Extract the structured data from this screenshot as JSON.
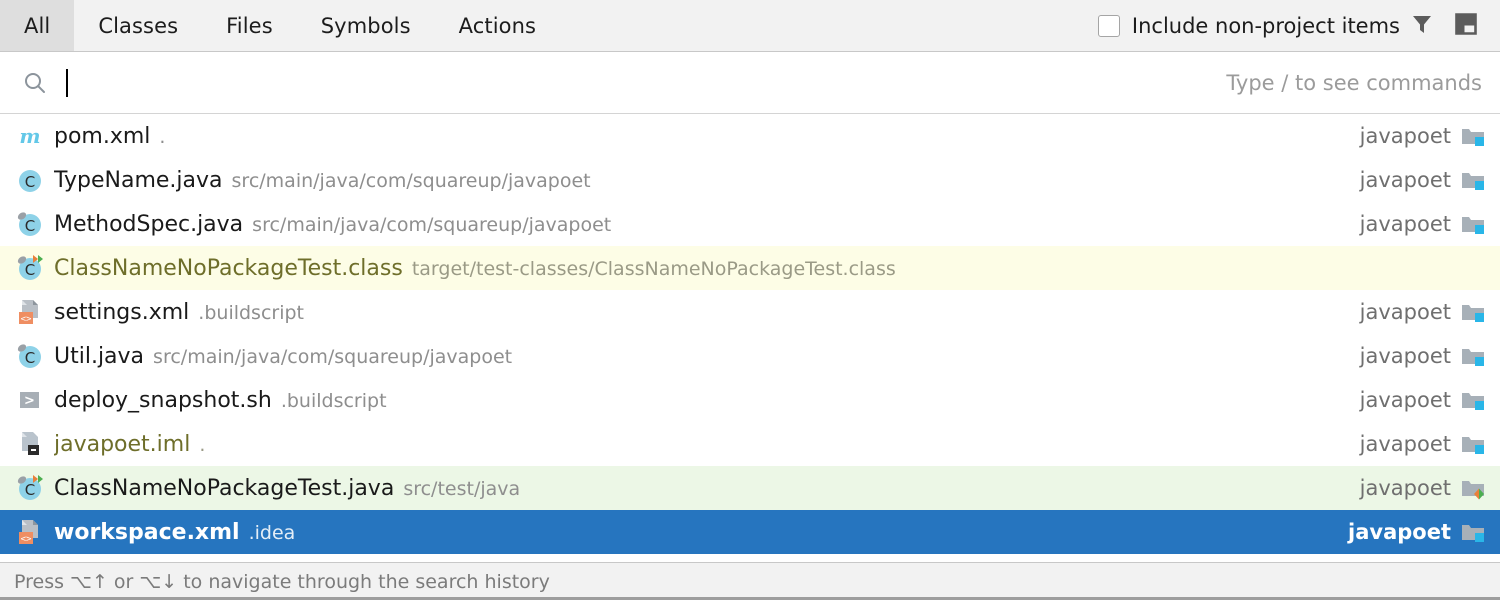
{
  "header": {
    "tabs": [
      {
        "label": "All",
        "active": true
      },
      {
        "label": "Classes",
        "active": false
      },
      {
        "label": "Files",
        "active": false
      },
      {
        "label": "Symbols",
        "active": false
      },
      {
        "label": "Actions",
        "active": false
      }
    ],
    "checkbox": {
      "label": "Include non-project items",
      "checked": false
    },
    "filter_icon": "filter-funnel-icon",
    "preview_icon": "preview-panel-icon"
  },
  "search": {
    "icon": "search-icon",
    "value": "",
    "placeholder": "",
    "hint": "Type / to see commands"
  },
  "results": [
    {
      "name": "pom.xml",
      "location": ".",
      "icon": "maven-file-icon",
      "module": "javapoet",
      "module_icon": "module-folder-icon",
      "background": "white",
      "text_style": "normal"
    },
    {
      "name": "TypeName.java",
      "location": "src/main/java/com/squareup/javapoet",
      "icon": "java-class-icon",
      "module": "javapoet",
      "module_icon": "module-folder-icon",
      "background": "white",
      "text_style": "normal"
    },
    {
      "name": "MethodSpec.java",
      "location": "src/main/java/com/squareup/javapoet",
      "icon": "java-class-excluded-icon",
      "module": "javapoet",
      "module_icon": "module-folder-icon",
      "background": "white",
      "text_style": "normal"
    },
    {
      "name": "ClassNameNoPackageTest.class",
      "location": "target/test-classes/ClassNameNoPackageTest.class",
      "icon": "java-class-test-compiled-icon",
      "module": "",
      "module_icon": "",
      "background": "yellow",
      "text_style": "olive"
    },
    {
      "name": "settings.xml",
      "location": ".buildscript",
      "icon": "xml-file-icon",
      "module": "javapoet",
      "module_icon": "module-folder-icon",
      "background": "white",
      "text_style": "normal"
    },
    {
      "name": "Util.java",
      "location": "src/main/java/com/squareup/javapoet",
      "icon": "java-class-excluded-icon",
      "module": "javapoet",
      "module_icon": "module-folder-icon",
      "background": "white",
      "text_style": "normal"
    },
    {
      "name": "deploy_snapshot.sh",
      "location": ".buildscript",
      "icon": "shell-script-icon",
      "module": "javapoet",
      "module_icon": "module-folder-icon",
      "background": "white",
      "text_style": "normal"
    },
    {
      "name": "javapoet.iml",
      "location": ".",
      "icon": "iml-module-file-icon",
      "module": "javapoet",
      "module_icon": "module-folder-icon",
      "background": "white",
      "text_style": "olive"
    },
    {
      "name": "ClassNameNoPackageTest.java",
      "location": "src/test/java",
      "icon": "java-class-test-icon",
      "module": "javapoet",
      "module_icon": "module-folder-test-icon",
      "background": "green",
      "text_style": "normal"
    },
    {
      "name": "workspace.xml",
      "location": ".idea",
      "icon": "xml-file-icon",
      "module": "javapoet",
      "module_icon": "module-folder-icon",
      "background": "selected",
      "text_style": "normal"
    }
  ],
  "status": {
    "text": "Press ⌥↑ or ⌥↓ to navigate through the search history"
  },
  "colors": {
    "header_bg": "#f2f2f2",
    "tab_active_bg": "#dedede",
    "selection_bg": "#2675bf",
    "library_row_bg": "#fdfde6",
    "test_row_bg": "#ecf7e6",
    "olive_text": "#6e6e2a",
    "muted_text": "#8e8e8e",
    "accent_blue": "#29b6e8"
  }
}
